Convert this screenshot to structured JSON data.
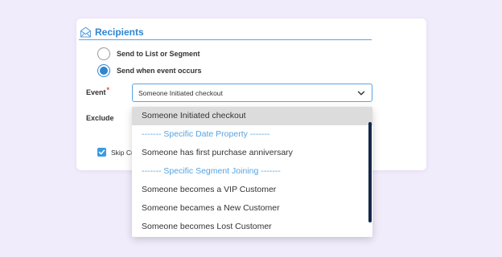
{
  "recipients": {
    "title": "Recipients",
    "icon": "envelope-icon",
    "options": [
      {
        "label": "Send to List or Segment",
        "checked": false
      },
      {
        "label": "Send when event occurs",
        "checked": true
      }
    ]
  },
  "event_field": {
    "label": "Event",
    "required_mark": "*",
    "value": "Someone Initiated checkout"
  },
  "exclude_field": {
    "label": "Exclude"
  },
  "skip_checkbox": {
    "label": "Skip Cu",
    "checked": true
  },
  "dropdown": {
    "items": [
      {
        "label": "Someone Initiated checkout",
        "type": "option",
        "selected": true
      },
      {
        "label": "------- Specific Date Property -------",
        "type": "group"
      },
      {
        "label": "Someone has first purchase anniversary",
        "type": "option"
      },
      {
        "label": "------- Specific Segment Joining -------",
        "type": "group"
      },
      {
        "label": "Someone becomes a VIP Customer",
        "type": "option"
      },
      {
        "label": "Someone becames a New Customer",
        "type": "option"
      },
      {
        "label": "Someone becomes Lost Customer",
        "type": "option"
      }
    ]
  },
  "colors": {
    "accent": "#2e86d1",
    "group_text": "#5aa3e0",
    "background": "#f1ecfb",
    "scrollbar": "#14284b"
  }
}
